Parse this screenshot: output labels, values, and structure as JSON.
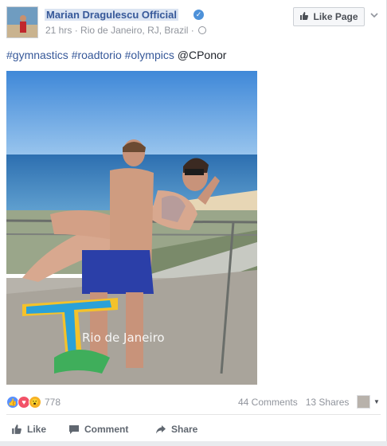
{
  "post": {
    "page_name": "Marian Dragulescu Official",
    "time": "21 hrs",
    "location": "Rio de Janeiro, RJ, Brazil",
    "like_page_label": "Like Page",
    "text_hashtags": "#gymnastics #roadtorio #olympics",
    "text_mention": "@CPonor",
    "photo_watermark": "Rio de Janeiro"
  },
  "footer": {
    "reaction_count": "778",
    "comments": "44 Comments",
    "shares": "13 Shares"
  },
  "actions": {
    "like": "Like",
    "comment": "Comment",
    "share": "Share"
  },
  "icons": [
    "verified-icon",
    "globe-icon",
    "thumbs-up-icon",
    "chevron-down-icon",
    "like-reaction-icon",
    "love-reaction-icon",
    "wow-reaction-icon",
    "comment-icon",
    "share-icon"
  ],
  "colors": {
    "link": "#365899",
    "muted": "#90949c",
    "like_blue": "#5890ff",
    "love_red": "#f25268",
    "wow_yellow": "#f7b125"
  }
}
